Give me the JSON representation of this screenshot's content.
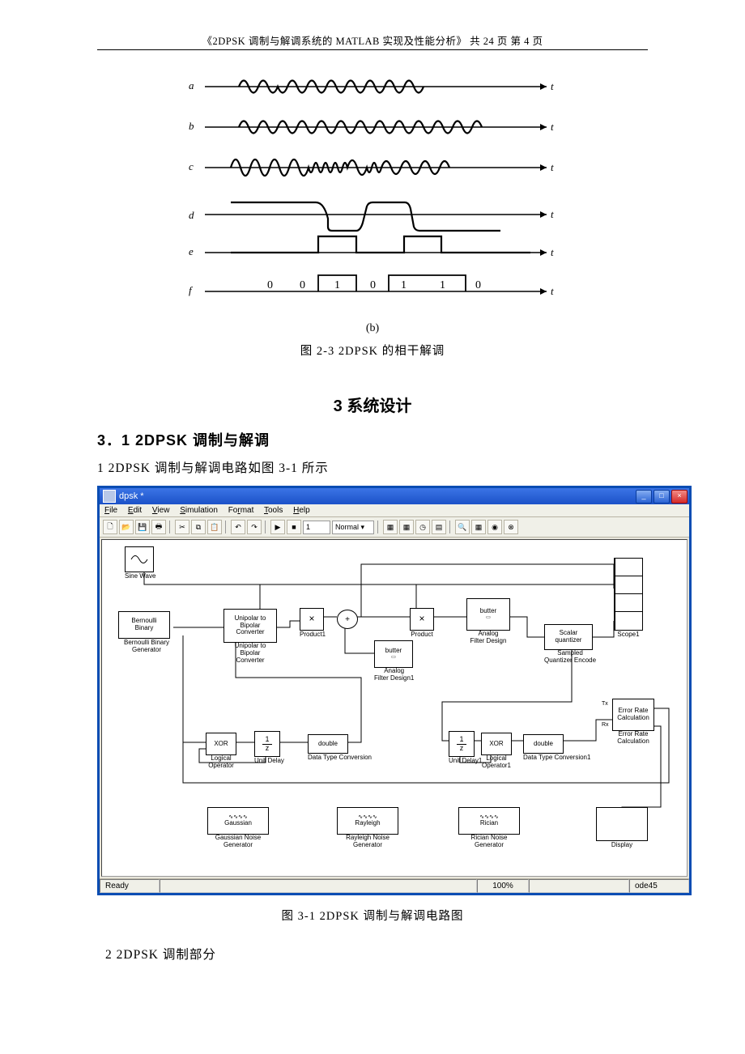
{
  "header": "《2DPSK 调制与解调系统的 MATLAB 实现及性能分析》  共 24 页  第 4 页",
  "waveform": {
    "rows": [
      "a",
      "b",
      "c",
      "d",
      "e",
      "f"
    ],
    "digits": [
      "0",
      "0",
      "1",
      "0",
      "1",
      "1",
      "0"
    ],
    "axis": "t"
  },
  "caption_b": "(b)",
  "caption_fig23": "图 2-3   2DPSK 的相干解调",
  "section3": "3 系统设计",
  "sub31": "3．1   2DPSK 调制与解调",
  "line1": "1    2DPSK 调制与解调电路如图 3-1 所示",
  "sim": {
    "title": "dpsk *",
    "menu": [
      "File",
      "Edit",
      "View",
      "Simulation",
      "Format",
      "Tools",
      "Help"
    ],
    "toolbar": {
      "mode": "Normal",
      "stoptime": "1"
    },
    "status": {
      "left": "Ready",
      "zoom": "100%",
      "solver": "ode45"
    },
    "blocks": {
      "sine": {
        "label": "Sine Wave"
      },
      "bern": {
        "box": "Bernoulli\nBinary",
        "label": "Bernoulli Binary\nGenerator"
      },
      "u2b": {
        "box": "Unipolar to\nBipolar\nConverter",
        "label": "Unipolar to\nBipolar\nConverter"
      },
      "prod1": {
        "sym": "×",
        "label": "Product1"
      },
      "sum": {
        "sym": "+"
      },
      "afd1": {
        "box": "butter",
        "label": "Analog\nFilter Design1"
      },
      "prod": {
        "sym": "×",
        "label": "Product"
      },
      "afd": {
        "box": "butter",
        "label": "Analog\nFilter Design"
      },
      "sq": {
        "box": "Scalar\nquantizer",
        "label": "Sampled\nQuantizer Encode"
      },
      "scope": {
        "label": "Scope1"
      },
      "xor": {
        "box": "XOR",
        "label": "Logical\nOperator"
      },
      "ud": {
        "box": "1\nz",
        "label": "Unit Delay"
      },
      "dtc": {
        "box": "double",
        "label": "Data Type Conversion"
      },
      "ud1": {
        "box": "1\nz",
        "label": "Unit Delay1"
      },
      "xor1": {
        "box": "XOR",
        "label": "Logical\nOperator1"
      },
      "dtc1": {
        "box": "double",
        "label": "Data Type Conversion1"
      },
      "erc": {
        "box": "Error Rate\nCalculation",
        "label": "Error Rate\nCalculation"
      },
      "gauss": {
        "box": "Gaussian",
        "label": "Gaussian Noise\nGenerator"
      },
      "rayl": {
        "box": "Rayleigh",
        "label": "Rayleigh Noise\nGenerator"
      },
      "ric": {
        "box": "Rician",
        "label": "Rician Noise\nGenerator"
      },
      "disp": {
        "label": "Display"
      }
    }
  },
  "caption_fig31": "图 3-1 2DPSK 调制与解调电路图",
  "line2": "2    2DPSK 调制部分"
}
